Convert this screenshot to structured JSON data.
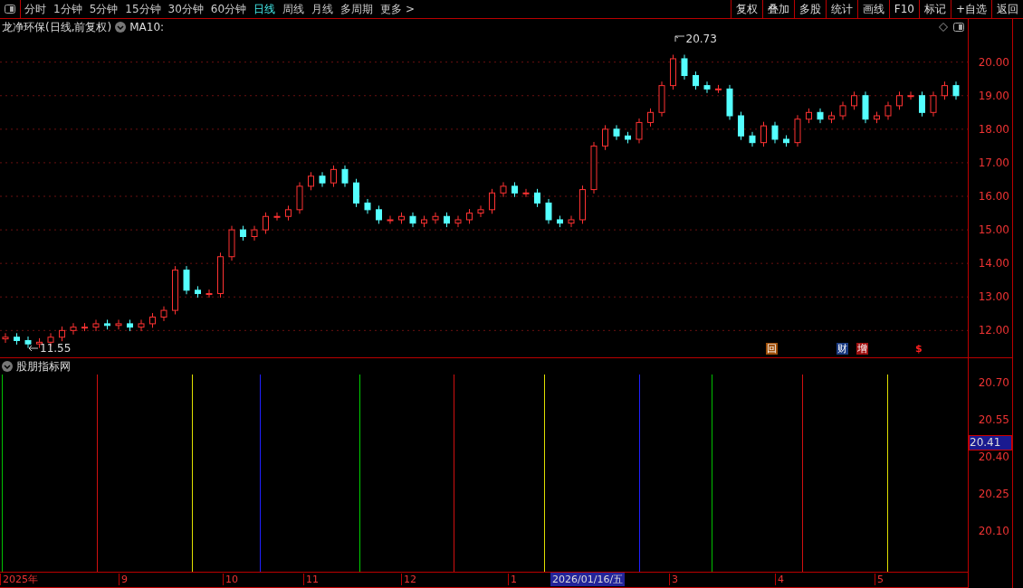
{
  "toolbar": {
    "periods": [
      {
        "label": "分时",
        "selected": false
      },
      {
        "label": "1分钟",
        "selected": false
      },
      {
        "label": "5分钟",
        "selected": false
      },
      {
        "label": "15分钟",
        "selected": false
      },
      {
        "label": "30分钟",
        "selected": false
      },
      {
        "label": "60分钟",
        "selected": false
      },
      {
        "label": "日线",
        "selected": true
      },
      {
        "label": "周线",
        "selected": false
      },
      {
        "label": "月线",
        "selected": false
      },
      {
        "label": "多周期",
        "selected": false
      },
      {
        "label": "更多 >",
        "selected": false
      }
    ],
    "actions": [
      "复权",
      "叠加",
      "多股",
      "统计",
      "画线",
      "F10",
      "标记",
      "+自选",
      "返回"
    ]
  },
  "main_panel": {
    "title": "龙净环保(日线,前复权)",
    "indicator": "MA10:",
    "high_label": "20.73",
    "low_label": "11.55",
    "axis_labels": [
      "20.00",
      "19.00",
      "18.00",
      "17.00",
      "16.00",
      "15.00",
      "14.00",
      "13.00",
      "12.00"
    ],
    "events": [
      {
        "label": "回",
        "kind": "box",
        "color": "#a0500a"
      },
      {
        "label": "财",
        "kind": "box",
        "color": "#1a3a80"
      },
      {
        "label": "增",
        "kind": "box",
        "color": "#a01010"
      },
      {
        "label": "$",
        "kind": "plain",
        "color": "#ff2020"
      }
    ]
  },
  "indicator_panel": {
    "title": "股朋指标网",
    "axis_labels": [
      "20.70",
      "20.55",
      "20.40",
      "20.25",
      "20.10"
    ],
    "current_value": "20.41",
    "signal_lines": [
      {
        "color": "#00c000"
      },
      {
        "color": "#d01010"
      },
      {
        "color": "#e0e000"
      },
      {
        "color": "#2020ff"
      },
      {
        "color": "#00d000"
      },
      {
        "color": "#d01010"
      },
      {
        "color": "#e0e000"
      },
      {
        "color": "#2020ff"
      },
      {
        "color": "#00c000"
      },
      {
        "color": "#d01010"
      },
      {
        "color": "#e0e000"
      }
    ]
  },
  "time_axis": {
    "labels": [
      "2025年",
      "9",
      "10",
      "11",
      "12",
      "1",
      "3",
      "4",
      "5"
    ],
    "cursor_date": "2026/01/16/五"
  }
}
